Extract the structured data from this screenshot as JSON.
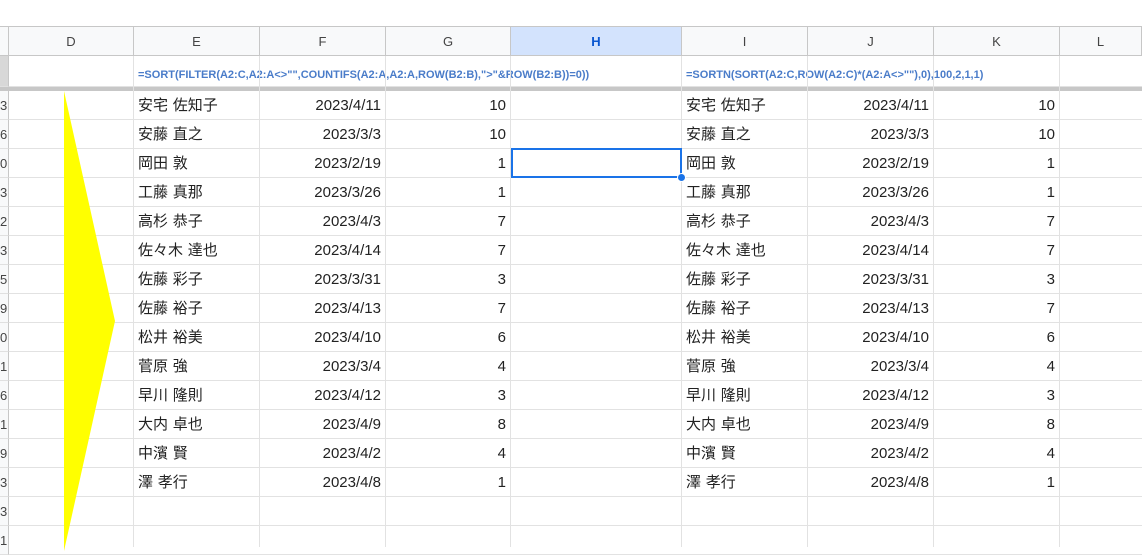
{
  "columns": [
    "D",
    "E",
    "F",
    "G",
    "H",
    "I",
    "J",
    "K",
    "L"
  ],
  "selected_column": "H",
  "row_numbers": [
    "",
    "3",
    "6",
    "0",
    "3",
    "2",
    "3",
    "5",
    "9",
    "0",
    "1",
    "6",
    "1",
    "9",
    "3",
    "3",
    "1"
  ],
  "formula_left": "=SORT(FILTER(A2:C,A2:A<>\"\",COUNTIFS(A2:A,A2:A,ROW(B2:B),\">\"&ROW(B2:B))=0))",
  "formula_right": "=SORTN(SORT(A2:C,ROW(A2:C)*(A2:A<>\"\"),0),100,2,1,1)",
  "rows_left": [
    {
      "name": "安宅 佐知子",
      "date": "2023/4/11",
      "value": "10"
    },
    {
      "name": "安藤 直之",
      "date": "2023/3/3",
      "value": "10"
    },
    {
      "name": "岡田 敦",
      "date": "2023/2/19",
      "value": "1"
    },
    {
      "name": "工藤 真那",
      "date": "2023/3/26",
      "value": "1"
    },
    {
      "name": "高杉 恭子",
      "date": "2023/4/3",
      "value": "7"
    },
    {
      "name": "佐々木 達也",
      "date": "2023/4/14",
      "value": "7"
    },
    {
      "name": "佐藤 彩子",
      "date": "2023/3/31",
      "value": "3"
    },
    {
      "name": "佐藤 裕子",
      "date": "2023/4/13",
      "value": "7"
    },
    {
      "name": "松井 裕美",
      "date": "2023/4/10",
      "value": "6"
    },
    {
      "name": "菅原 強",
      "date": "2023/3/4",
      "value": "4"
    },
    {
      "name": "早川 隆則",
      "date": "2023/4/12",
      "value": "3"
    },
    {
      "name": "大内 卓也",
      "date": "2023/4/9",
      "value": "8"
    },
    {
      "name": "中濱 賢",
      "date": "2023/4/2",
      "value": "4"
    },
    {
      "name": "澤 孝行",
      "date": "2023/4/8",
      "value": "1"
    }
  ],
  "rows_right": [
    {
      "name": "安宅 佐知子",
      "date": "2023/4/11",
      "value": "10"
    },
    {
      "name": "安藤 直之",
      "date": "2023/3/3",
      "value": "10"
    },
    {
      "name": "岡田 敦",
      "date": "2023/2/19",
      "value": "1"
    },
    {
      "name": "工藤 真那",
      "date": "2023/3/26",
      "value": "1"
    },
    {
      "name": "高杉 恭子",
      "date": "2023/4/3",
      "value": "7"
    },
    {
      "name": "佐々木 達也",
      "date": "2023/4/14",
      "value": "7"
    },
    {
      "name": "佐藤 彩子",
      "date": "2023/3/31",
      "value": "3"
    },
    {
      "name": "佐藤 裕子",
      "date": "2023/4/13",
      "value": "7"
    },
    {
      "name": "松井 裕美",
      "date": "2023/4/10",
      "value": "6"
    },
    {
      "name": "菅原 強",
      "date": "2023/3/4",
      "value": "4"
    },
    {
      "name": "早川 隆則",
      "date": "2023/4/12",
      "value": "3"
    },
    {
      "name": "大内 卓也",
      "date": "2023/4/9",
      "value": "8"
    },
    {
      "name": "中濱 賢",
      "date": "2023/4/2",
      "value": "4"
    },
    {
      "name": "澤 孝行",
      "date": "2023/4/8",
      "value": "1"
    }
  ],
  "colors": {
    "arrow": "#ffff00",
    "selection": "#1a73e8",
    "formula_text": "#4a7cc9",
    "header_selected": "#d3e3fd"
  }
}
